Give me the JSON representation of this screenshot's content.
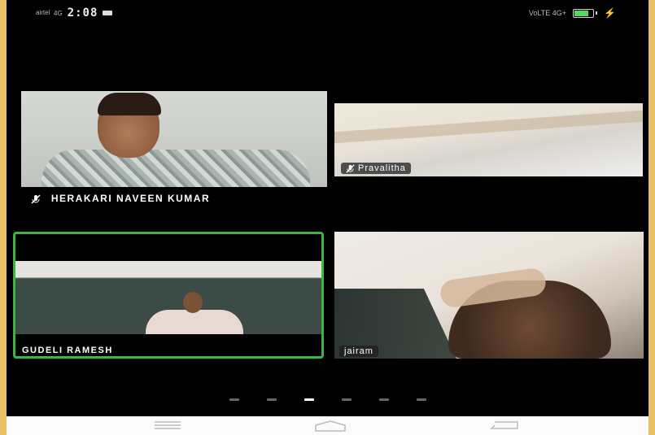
{
  "status_bar": {
    "carrier": "airtel",
    "network": "4G",
    "time": "2:08",
    "right_indicators": "VoLTE 4G+"
  },
  "participants": [
    {
      "name": "HERAKARI NAVEEN KUMAR",
      "muted": true
    },
    {
      "name": "Pravalitha",
      "muted": true
    },
    {
      "name": "GUDELI RAMESH",
      "active_speaker": true
    },
    {
      "name": "jairam"
    }
  ],
  "pager": {
    "count": 6,
    "active_index": 2
  },
  "colors": {
    "active_speaker_border": "#3cb44a",
    "background": "#000000"
  },
  "nav": [
    "menu-icon",
    "home-icon",
    "back-icon"
  ]
}
